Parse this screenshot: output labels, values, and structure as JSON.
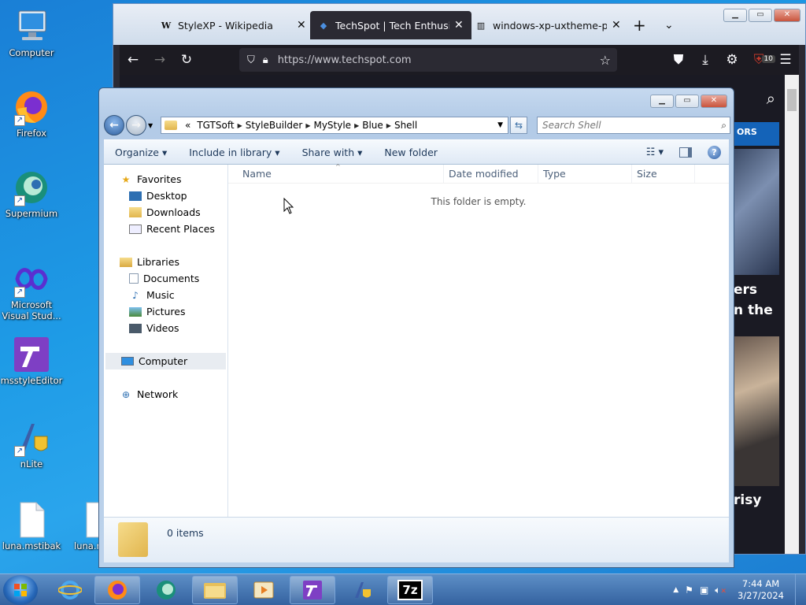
{
  "desktop": {
    "icons": [
      {
        "label": "Computer",
        "icon": "computer-icon"
      },
      {
        "label": "Firefox",
        "icon": "firefox-icon"
      },
      {
        "label": "Supermium",
        "icon": "supermium-icon"
      },
      {
        "label": "Microsoft Visual Stud...",
        "icon": "visual-studio-icon"
      },
      {
        "label": "msstyleEditor",
        "icon": "msstyleeditor-icon"
      },
      {
        "label": "nLite",
        "icon": "nlite-icon"
      },
      {
        "label": "luna.mstibak",
        "icon": "file-icon"
      },
      {
        "label": "luna.n",
        "icon": "file-icon"
      }
    ]
  },
  "browser": {
    "tabs": [
      {
        "label": "StyleXP - Wikipedia",
        "favicon": "W"
      },
      {
        "label": "TechSpot | Tech Enthusiast",
        "favicon": "◆"
      },
      {
        "label": "windows-xp-uxtheme-patc",
        "favicon": "▥"
      }
    ],
    "url": "https://www.techspot.com",
    "extension_badge": "10",
    "page": {
      "promo": "ORS",
      "headline1_a": "ers",
      "headline1_b": "n the",
      "headline2": "risy"
    }
  },
  "explorer": {
    "breadcrumb": [
      "«",
      "TGTSoft",
      "StyleBuilder",
      "MyStyle",
      "Blue",
      "Shell"
    ],
    "search_placeholder": "Search Shell",
    "toolbar": {
      "organize": "Organize ▾",
      "include_in_library": "Include in library ▾",
      "share_with": "Share with ▾",
      "new_folder": "New folder"
    },
    "nav": {
      "favorites": "Favorites",
      "desktop": "Desktop",
      "downloads": "Downloads",
      "recent_places": "Recent Places",
      "libraries": "Libraries",
      "documents": "Documents",
      "music": "Music",
      "pictures": "Pictures",
      "videos": "Videos",
      "computer": "Computer",
      "network": "Network"
    },
    "columns": {
      "name": "Name",
      "date_modified": "Date modified",
      "type": "Type",
      "size": "Size"
    },
    "empty_message": "This folder is empty.",
    "item_count": "0 items"
  },
  "taskbar": {
    "time": "7:44 AM",
    "date": "3/27/2024",
    "app_7z": "7z"
  }
}
